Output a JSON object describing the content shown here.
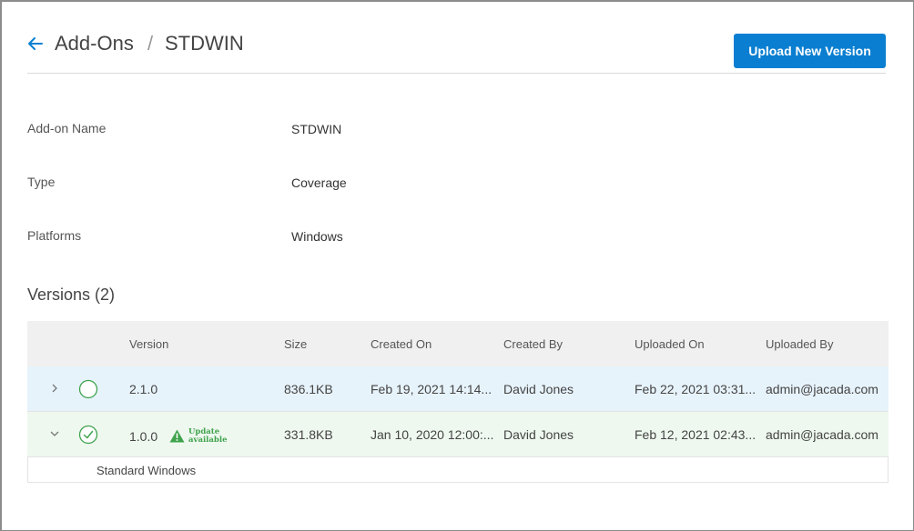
{
  "breadcrumb": {
    "parent": "Add-Ons",
    "separator": "/",
    "current": "STDWIN"
  },
  "header": {
    "upload_button": "Upload New Version"
  },
  "details": [
    {
      "label": "Add-on Name",
      "value": "STDWIN"
    },
    {
      "label": "Type",
      "value": "Coverage"
    },
    {
      "label": "Platforms",
      "value": "Windows"
    }
  ],
  "versions": {
    "title": "Versions (2)",
    "columns": [
      "Version",
      "Size",
      "Created On",
      "Created By",
      "Uploaded On",
      "Uploaded By"
    ],
    "rows": [
      {
        "version": "2.1.0",
        "size": "836.1KB",
        "created_on": "Feb 19, 2021 14:14...",
        "created_by": "David Jones",
        "uploaded_on": "Feb 22, 2021 03:31...",
        "uploaded_by": "admin@jacada.com",
        "expanded": false,
        "selected": false
      },
      {
        "version": "1.0.0",
        "update_line1": "Update",
        "update_line2": "available",
        "size": "331.8KB",
        "created_on": "Jan 10, 2020 12:00:...",
        "created_by": "David Jones",
        "uploaded_on": "Feb 12, 2021 02:43...",
        "uploaded_by": "admin@jacada.com",
        "expanded": true,
        "selected": true,
        "detail": "Standard Windows"
      }
    ]
  },
  "colors": {
    "accent": "#0a7fd1",
    "success": "#3fa34d",
    "row_hover": "#e7f3fb",
    "row_selected": "#eef8ef"
  },
  "icons": {
    "back": "arrow-left-icon",
    "collapsed": "chevron-right-icon",
    "expanded": "chevron-down-icon",
    "unselected": "empty-circle-icon",
    "selected": "check-circle-icon",
    "warning": "warning-triangle-icon"
  }
}
